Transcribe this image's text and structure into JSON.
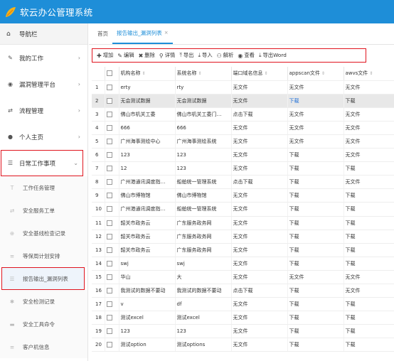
{
  "app": {
    "title": "软云办公管理系统"
  },
  "sidebar": {
    "header": "导航栏",
    "items": [
      {
        "label": "我的工作",
        "icon": "pencil-icon"
      },
      {
        "label": "漏洞管理平台",
        "icon": "eye-icon"
      },
      {
        "label": "流程管理",
        "icon": "shuffle-icon"
      },
      {
        "label": "个人主页",
        "icon": "person-icon"
      },
      {
        "label": "日常工作事项",
        "icon": "list-icon"
      }
    ],
    "subitems": [
      {
        "label": "工作任务管理"
      },
      {
        "label": "安全服务工单"
      },
      {
        "label": "安全基线检查记录"
      },
      {
        "label": "等保周计划安排"
      },
      {
        "label": "报告输出_漏洞列表"
      },
      {
        "label": "安全检测记录"
      },
      {
        "label": "安全工具命令"
      },
      {
        "label": "客户机信息"
      }
    ]
  },
  "tabs": {
    "home": "首页",
    "active": "报告输出_漏洞列表",
    "close": "×"
  },
  "toolbar": {
    "add": "增加",
    "edit": "编辑",
    "delete": "删除",
    "detail": "详情",
    "export": "导出",
    "import": "导入",
    "parse": "解析",
    "view": "查看",
    "export_word": "导出Word"
  },
  "table": {
    "headers": {
      "name": "机构名称",
      "sys": "系统名称",
      "domain": "端口域名信息",
      "appscan": "appscan文件",
      "awvs": "awvs文件"
    },
    "rows": [
      {
        "idx": "1",
        "name": "erty",
        "sys": "rty",
        "domain": "无文件",
        "appscan": "无文件",
        "awvs": "无文件"
      },
      {
        "idx": "2",
        "name": "无会测试数据",
        "sys": "无会测试数据",
        "domain": "无文件",
        "appscan": "下载",
        "awvs": "下载"
      },
      {
        "idx": "3",
        "name": "佛山市机关工委",
        "sys": "佛山市机关工委门…",
        "domain": "点击下载",
        "appscan": "无文件",
        "awvs": "无文件"
      },
      {
        "idx": "4",
        "name": "666",
        "sys": "666",
        "domain": "无文件",
        "appscan": "无文件",
        "awvs": "无文件"
      },
      {
        "idx": "5",
        "name": "广州海事测绘中心",
        "sys": "广州海事测绘系统",
        "domain": "无文件",
        "appscan": "无文件",
        "awvs": "无文件"
      },
      {
        "idx": "6",
        "name": "123",
        "sys": "123",
        "domain": "无文件",
        "appscan": "下载",
        "awvs": "无文件"
      },
      {
        "idx": "7",
        "name": "12",
        "sys": "123",
        "domain": "无文件",
        "appscan": "下载",
        "awvs": "下载"
      },
      {
        "idx": "8",
        "name": "广州港通讯调度指…",
        "sys": "船舶统一管理系统",
        "domain": "点击下载",
        "appscan": "下载",
        "awvs": "无文件"
      },
      {
        "idx": "9",
        "name": "佛山市博物馆",
        "sys": "佛山市博物馆",
        "domain": "无文件",
        "appscan": "下载",
        "awvs": "下载"
      },
      {
        "idx": "10",
        "name": "广州港通讯调度指…",
        "sys": "船舶统一管理系统",
        "domain": "无文件",
        "appscan": "下载",
        "awvs": "下载"
      },
      {
        "idx": "11",
        "name": "韶关市政务云",
        "sys": "广东服务政务网",
        "domain": "无文件",
        "appscan": "下载",
        "awvs": "下载"
      },
      {
        "idx": "12",
        "name": "韶关市政务云",
        "sys": "广东服务政务网",
        "domain": "无文件",
        "appscan": "下载",
        "awvs": "下载"
      },
      {
        "idx": "13",
        "name": "韶关市政务云",
        "sys": "广东服务政务网",
        "domain": "无文件",
        "appscan": "下载",
        "awvs": "下载"
      },
      {
        "idx": "14",
        "name": "swj",
        "sys": "swj",
        "domain": "无文件",
        "appscan": "下载",
        "awvs": "下载"
      },
      {
        "idx": "15",
        "name": "华山",
        "sys": "大",
        "domain": "无文件",
        "appscan": "无文件",
        "awvs": "无文件"
      },
      {
        "idx": "16",
        "name": "我测试的数据不要动",
        "sys": "我测试的数据不要动",
        "domain": "点击下载",
        "appscan": "下载",
        "awvs": "无文件"
      },
      {
        "idx": "17",
        "name": "v",
        "sys": "df",
        "domain": "无文件",
        "appscan": "下载",
        "awvs": "下载"
      },
      {
        "idx": "18",
        "name": "测试excel",
        "sys": "测试excel",
        "domain": "无文件",
        "appscan": "下载",
        "awvs": "下载"
      },
      {
        "idx": "19",
        "name": "123",
        "sys": "123",
        "domain": "无文件",
        "appscan": "下载",
        "awvs": "下载"
      },
      {
        "idx": "20",
        "name": "测试option",
        "sys": "测试options",
        "domain": "无文件",
        "appscan": "下载",
        "awvs": "下载"
      }
    ]
  },
  "colors": {
    "brand": "#1e8ed8",
    "highlight_border": "#e0141e",
    "link": "#1e6fd8"
  }
}
